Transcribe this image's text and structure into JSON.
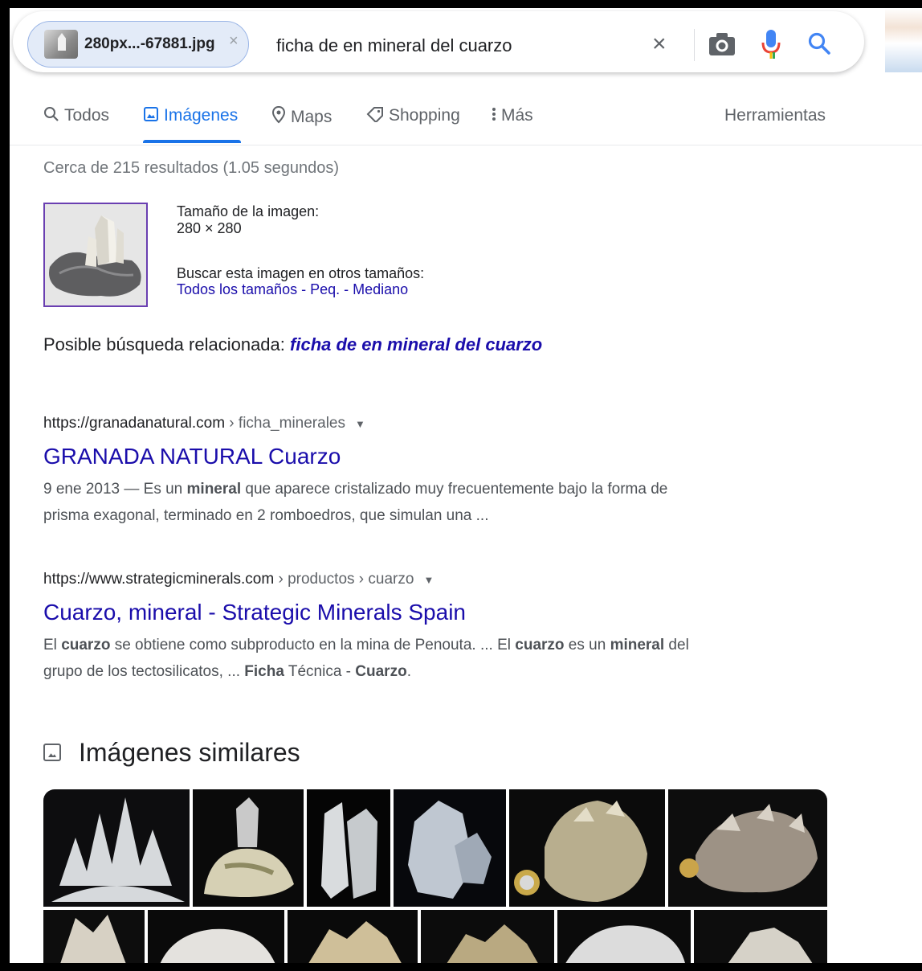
{
  "search": {
    "chip_label": "280px...-67881.jpg",
    "chip_close": "×",
    "query": "ficha de en mineral del cuarzo",
    "clear": "×"
  },
  "nav": {
    "tabs": [
      {
        "label": "Todos",
        "icon": "search-icon"
      },
      {
        "label": "Imágenes",
        "icon": "image-icon",
        "active": true
      },
      {
        "label": "Maps",
        "icon": "map-pin-icon"
      },
      {
        "label": "Shopping",
        "icon": "tag-icon"
      },
      {
        "label": "Más",
        "icon": "more-vert-icon"
      }
    ],
    "tools": "Herramientas"
  },
  "stats": "Cerca de 215 resultados (1.05 segundos)",
  "image_info": {
    "size_label": "Tamaño de la imagen:",
    "size_value": "280 × 280",
    "other_sizes_label": "Buscar esta imagen en otros tamaños:",
    "link_all": "Todos los tamaños",
    "sep1": " - ",
    "link_small": "Peq.",
    "sep2": " - ",
    "link_medium": "Mediano"
  },
  "related": {
    "label": "Posible búsqueda relacionada: ",
    "query": "ficha de en mineral del cuarzo"
  },
  "results": [
    {
      "domain": "https://granadanatural.com",
      "path": " › ficha_minerales",
      "title": "GRANADA NATURAL Cuarzo",
      "snippet_l1_a": "9 ene 2013 — Es un ",
      "snippet_l1_b": "mineral",
      "snippet_l1_c": " que aparece cristalizado muy frecuentemente bajo la forma de",
      "snippet_l2": "prisma exagonal, terminado en 2 romboedros, que simulan una ..."
    },
    {
      "domain": "https://www.strategicminerals.com",
      "path": " › productos › cuarzo",
      "title": "Cuarzo, mineral - Strategic Minerals Spain",
      "snippet_l1_a": "El ",
      "snippet_l1_b": "cuarzo",
      "snippet_l1_c": " se obtiene como subproducto en la mina de Penouta. ... El ",
      "snippet_l1_d": "cuarzo",
      "snippet_l1_e": " es un ",
      "snippet_l1_f": "mineral",
      "snippet_l1_g": " del",
      "snippet_l2_a": "grupo de los tectosilicatos, ... ",
      "snippet_l2_b": "Ficha",
      "snippet_l2_c": " Técnica - ",
      "snippet_l2_d": "Cuarzo",
      "snippet_l2_e": "."
    }
  ],
  "similar": {
    "heading": "Imágenes similares"
  },
  "colors": {
    "link": "#1a0dab",
    "accent": "#1a73e8",
    "gray_text": "#5f6368"
  }
}
